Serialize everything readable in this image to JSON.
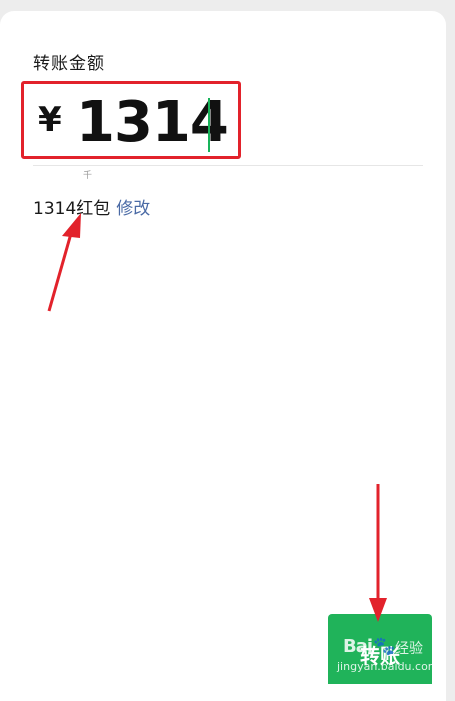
{
  "transfer": {
    "label": "转账金额",
    "currency_symbol": "¥",
    "amount": "1314",
    "unit_hint": "千"
  },
  "red_packet": {
    "text": "1314红包",
    "edit_link": "修改"
  },
  "action": {
    "button_label": "转账"
  },
  "watermark": {
    "brand": "Bai",
    "paw": "🐾",
    "experience": "经验",
    "url": "jingyan.baidu.com"
  },
  "colors": {
    "highlight_box": "#e2222b",
    "arrow": "#e2222b",
    "button": "#20b35a",
    "link": "#4a6aa5",
    "cursor": "#18b35a"
  }
}
